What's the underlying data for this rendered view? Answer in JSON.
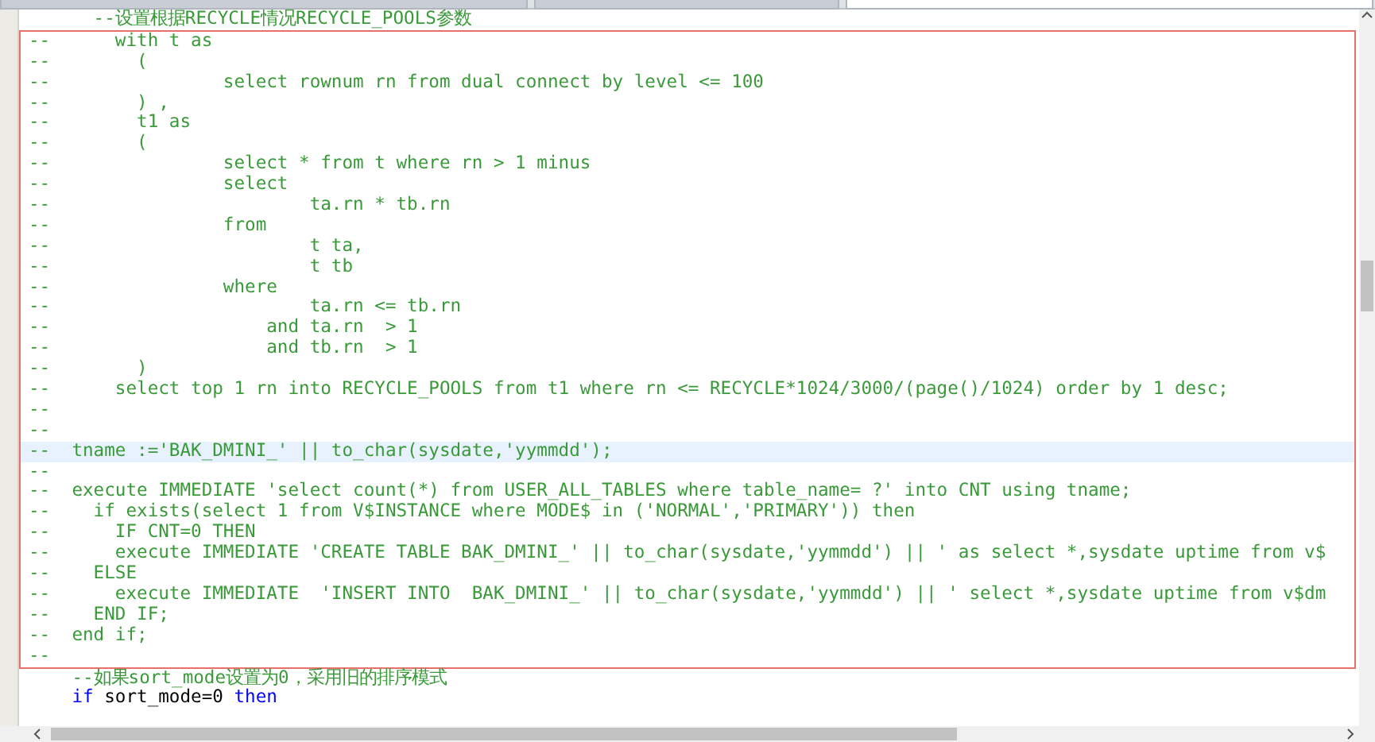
{
  "tabs": [
    {
      "selected": false
    },
    {
      "selected": false
    },
    {
      "selected": true
    }
  ],
  "editor": {
    "lines_before": [
      {
        "kind": "comment",
        "text": "      --设置根据RECYCLE情况RECYCLE_POOLS参数",
        "current": false
      }
    ],
    "framed_lines": [
      {
        "kind": "comment",
        "text": "--      with t as",
        "current": false
      },
      {
        "kind": "comment",
        "text": "--        (",
        "current": false
      },
      {
        "kind": "comment",
        "text": "--                select rownum rn from dual connect by level <= 100",
        "current": false
      },
      {
        "kind": "comment",
        "text": "--        ) ,",
        "current": false
      },
      {
        "kind": "comment",
        "text": "--        t1 as",
        "current": false
      },
      {
        "kind": "comment",
        "text": "--        (",
        "current": false
      },
      {
        "kind": "comment",
        "text": "--                select * from t where rn > 1 minus",
        "current": false
      },
      {
        "kind": "comment",
        "text": "--                select",
        "current": false
      },
      {
        "kind": "comment",
        "text": "--                        ta.rn * tb.rn",
        "current": false
      },
      {
        "kind": "comment",
        "text": "--                from",
        "current": false
      },
      {
        "kind": "comment",
        "text": "--                        t ta,",
        "current": false
      },
      {
        "kind": "comment",
        "text": "--                        t tb",
        "current": false
      },
      {
        "kind": "comment",
        "text": "--                where",
        "current": false
      },
      {
        "kind": "comment",
        "text": "--                        ta.rn <= tb.rn",
        "current": false
      },
      {
        "kind": "comment",
        "text": "--                    and ta.rn  > 1",
        "current": false
      },
      {
        "kind": "comment",
        "text": "--                    and tb.rn  > 1",
        "current": false
      },
      {
        "kind": "comment",
        "text": "--        )",
        "current": false
      },
      {
        "kind": "comment",
        "text": "--      select top 1 rn into RECYCLE_POOLS from t1 where rn <= RECYCLE*1024/3000/(page()/1024) order by 1 desc;",
        "current": false
      },
      {
        "kind": "comment",
        "text": "--",
        "current": false
      },
      {
        "kind": "comment",
        "text": "--",
        "current": false
      },
      {
        "kind": "comment",
        "text": "--  tname :='BAK_DMINI_' || to_char(sysdate,'yymmdd');",
        "current": true
      },
      {
        "kind": "comment",
        "text": "--",
        "current": false
      },
      {
        "kind": "comment",
        "text": "--  execute IMMEDIATE 'select count(*) from USER_ALL_TABLES where table_name= ?' into CNT using tname;",
        "current": false
      },
      {
        "kind": "comment",
        "text": "--    if exists(select 1 from V$INSTANCE where MODE$ in ('NORMAL','PRIMARY')) then",
        "current": false
      },
      {
        "kind": "comment",
        "text": "--      IF CNT=0 THEN",
        "current": false
      },
      {
        "kind": "comment",
        "text": "--      execute IMMEDIATE 'CREATE TABLE BAK_DMINI_' || to_char(sysdate,'yymmdd') || ' as select *,sysdate uptime from v$",
        "current": false
      },
      {
        "kind": "comment",
        "text": "--    ELSE",
        "current": false
      },
      {
        "kind": "comment",
        "text": "--      execute IMMEDIATE  'INSERT INTO  BAK_DMINI_' || to_char(sysdate,'yymmdd') || ' select *,sysdate uptime from v$dm",
        "current": false
      },
      {
        "kind": "comment",
        "text": "--    END IF;",
        "current": false
      },
      {
        "kind": "comment",
        "text": "--  end if;",
        "current": false
      },
      {
        "kind": "comment",
        "text": "--",
        "current": false
      }
    ],
    "lines_after": [
      {
        "kind": "comment",
        "text": "    --如果sort_mode设置为0，采用旧的排序模式",
        "current": false
      },
      {
        "kind": "code",
        "current": false,
        "tokens": [
          {
            "kind": "keyword",
            "text": "if"
          },
          {
            "kind": "plain",
            "text": "sort_mode=0"
          },
          {
            "kind": "keyword",
            "text": "then"
          }
        ]
      }
    ]
  }
}
